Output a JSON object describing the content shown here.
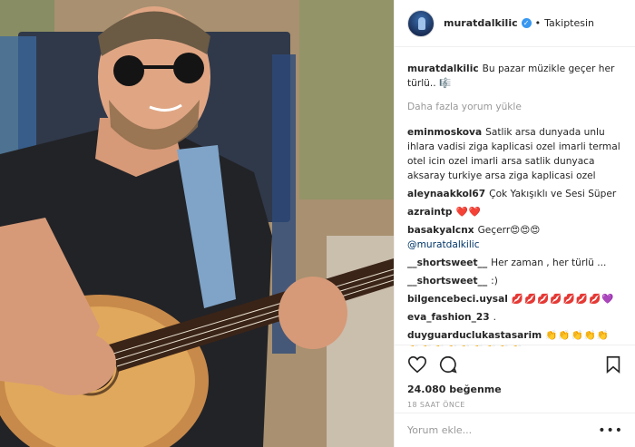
{
  "post": {
    "username": "muratdalkilic",
    "verified_mark": "✓",
    "separator": "•",
    "follow_state": "Takiptesin"
  },
  "caption": {
    "username": "muratdalkilic",
    "text": "Bu pazar müzikle geçer her türlü.. 🎼"
  },
  "load_more": "Daha fazla yorum yükle",
  "comments": [
    {
      "username": "eminmoskova",
      "text": "Satlik arsa dunyada unlu ihlara vadisi ziga kaplicasi ozel imarli termal otel icin ozel imarli arsa satlik dunyaca aksaray turkiye arsa ziga kaplicasi ozel"
    },
    {
      "username": "aleynaakkol67",
      "text": "Çok Yakışıklı ve Sesi Süper"
    },
    {
      "username": "azraintp",
      "text": "❤️❤️"
    },
    {
      "username": "basakyalcnx",
      "text": "Geçerr😍😍😍",
      "mention": "@muratdalkilic"
    },
    {
      "username": "__shortsweet__",
      "text": "Her zaman , her türlü ..."
    },
    {
      "username": "__shortsweet__",
      "text": ":)"
    },
    {
      "username": "bilgencebeci.uysal",
      "text": "💋💋💋💋💋💋💋💜"
    },
    {
      "username": "eva_fashion_23",
      "text": "."
    },
    {
      "username": "duyguarduclukastasarim",
      "text": "👏👏👏👏👏👏👏👏👏👏👏👏👏👏"
    }
  ],
  "actions": {
    "like_icon": "heart-outline",
    "comment_icon": "speech-bubble",
    "save_icon": "bookmark-outline"
  },
  "likes": "24.080 beğenme",
  "timestamp": "18 SAAT ÖNCE",
  "add_comment": {
    "placeholder": "Yorum ekle...",
    "more": "•••"
  }
}
